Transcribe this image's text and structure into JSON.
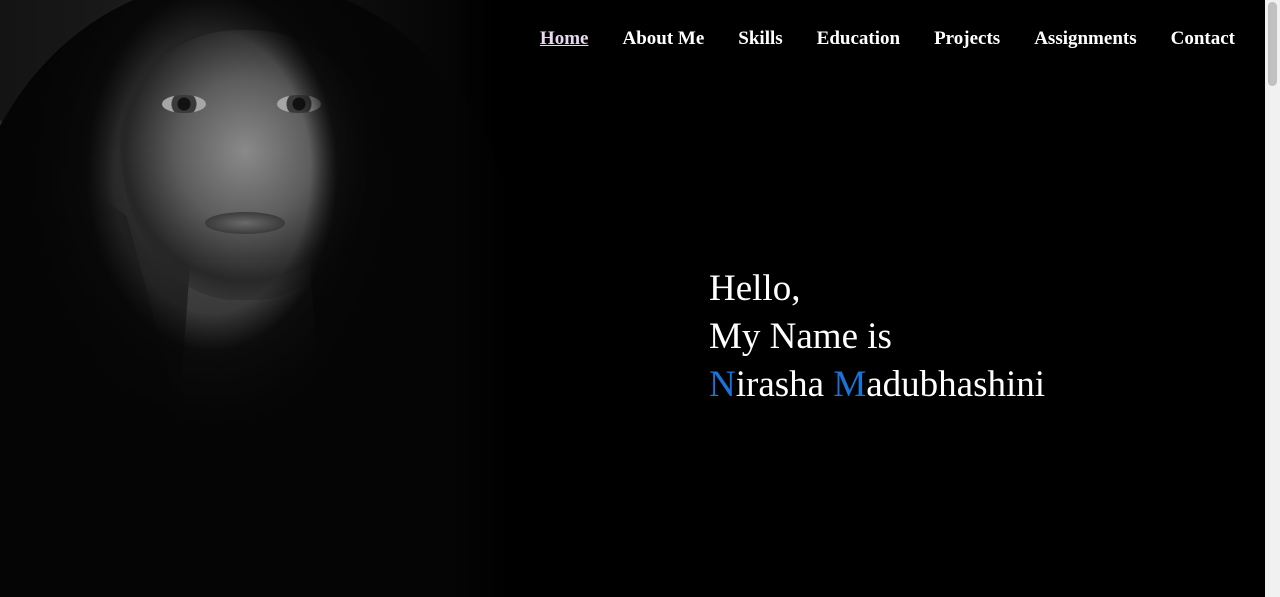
{
  "nav": {
    "items": [
      {
        "label": "Home",
        "active": true
      },
      {
        "label": "About Me"
      },
      {
        "label": "Skills"
      },
      {
        "label": "Education"
      },
      {
        "label": "Projects"
      },
      {
        "label": "Assignments"
      },
      {
        "label": "Contact"
      }
    ]
  },
  "hero": {
    "line1": "Hello,",
    "line2": "My Name is",
    "first_initial": "N",
    "first_rest": "irasha ",
    "last_initial": "M",
    "last_rest": "adubhashini",
    "accent_color": "#1a73d6",
    "background_color": "#000000",
    "text_color": "#ffffff"
  }
}
